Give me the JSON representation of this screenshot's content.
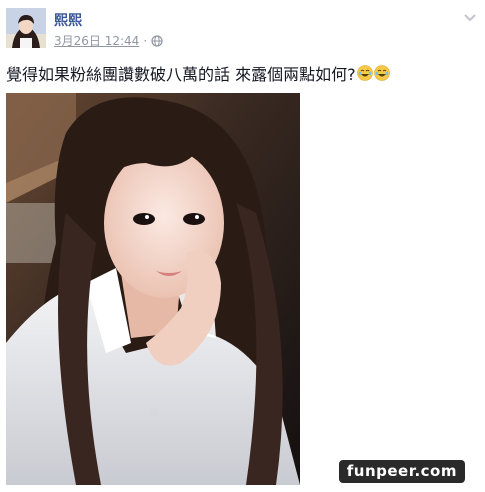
{
  "post": {
    "author": "熙熙",
    "timestamp": "3月26日 12:44",
    "separator": "·",
    "privacy_icon": "globe-icon",
    "menu_icon": "chevron-down-icon",
    "text": "覺得如果粉絲團讚數破八萬的話 來露個兩點如何?",
    "emojis": [
      "laughing-tears-emoji",
      "laughing-tears-emoji"
    ],
    "photo_icon": "portrait-photo"
  },
  "watermark": {
    "text": "funpeer.com"
  },
  "colors": {
    "link": "#3b5998",
    "meta": "#9197a3",
    "text": "#141823",
    "watermark_bg": "#2a2a2a"
  }
}
